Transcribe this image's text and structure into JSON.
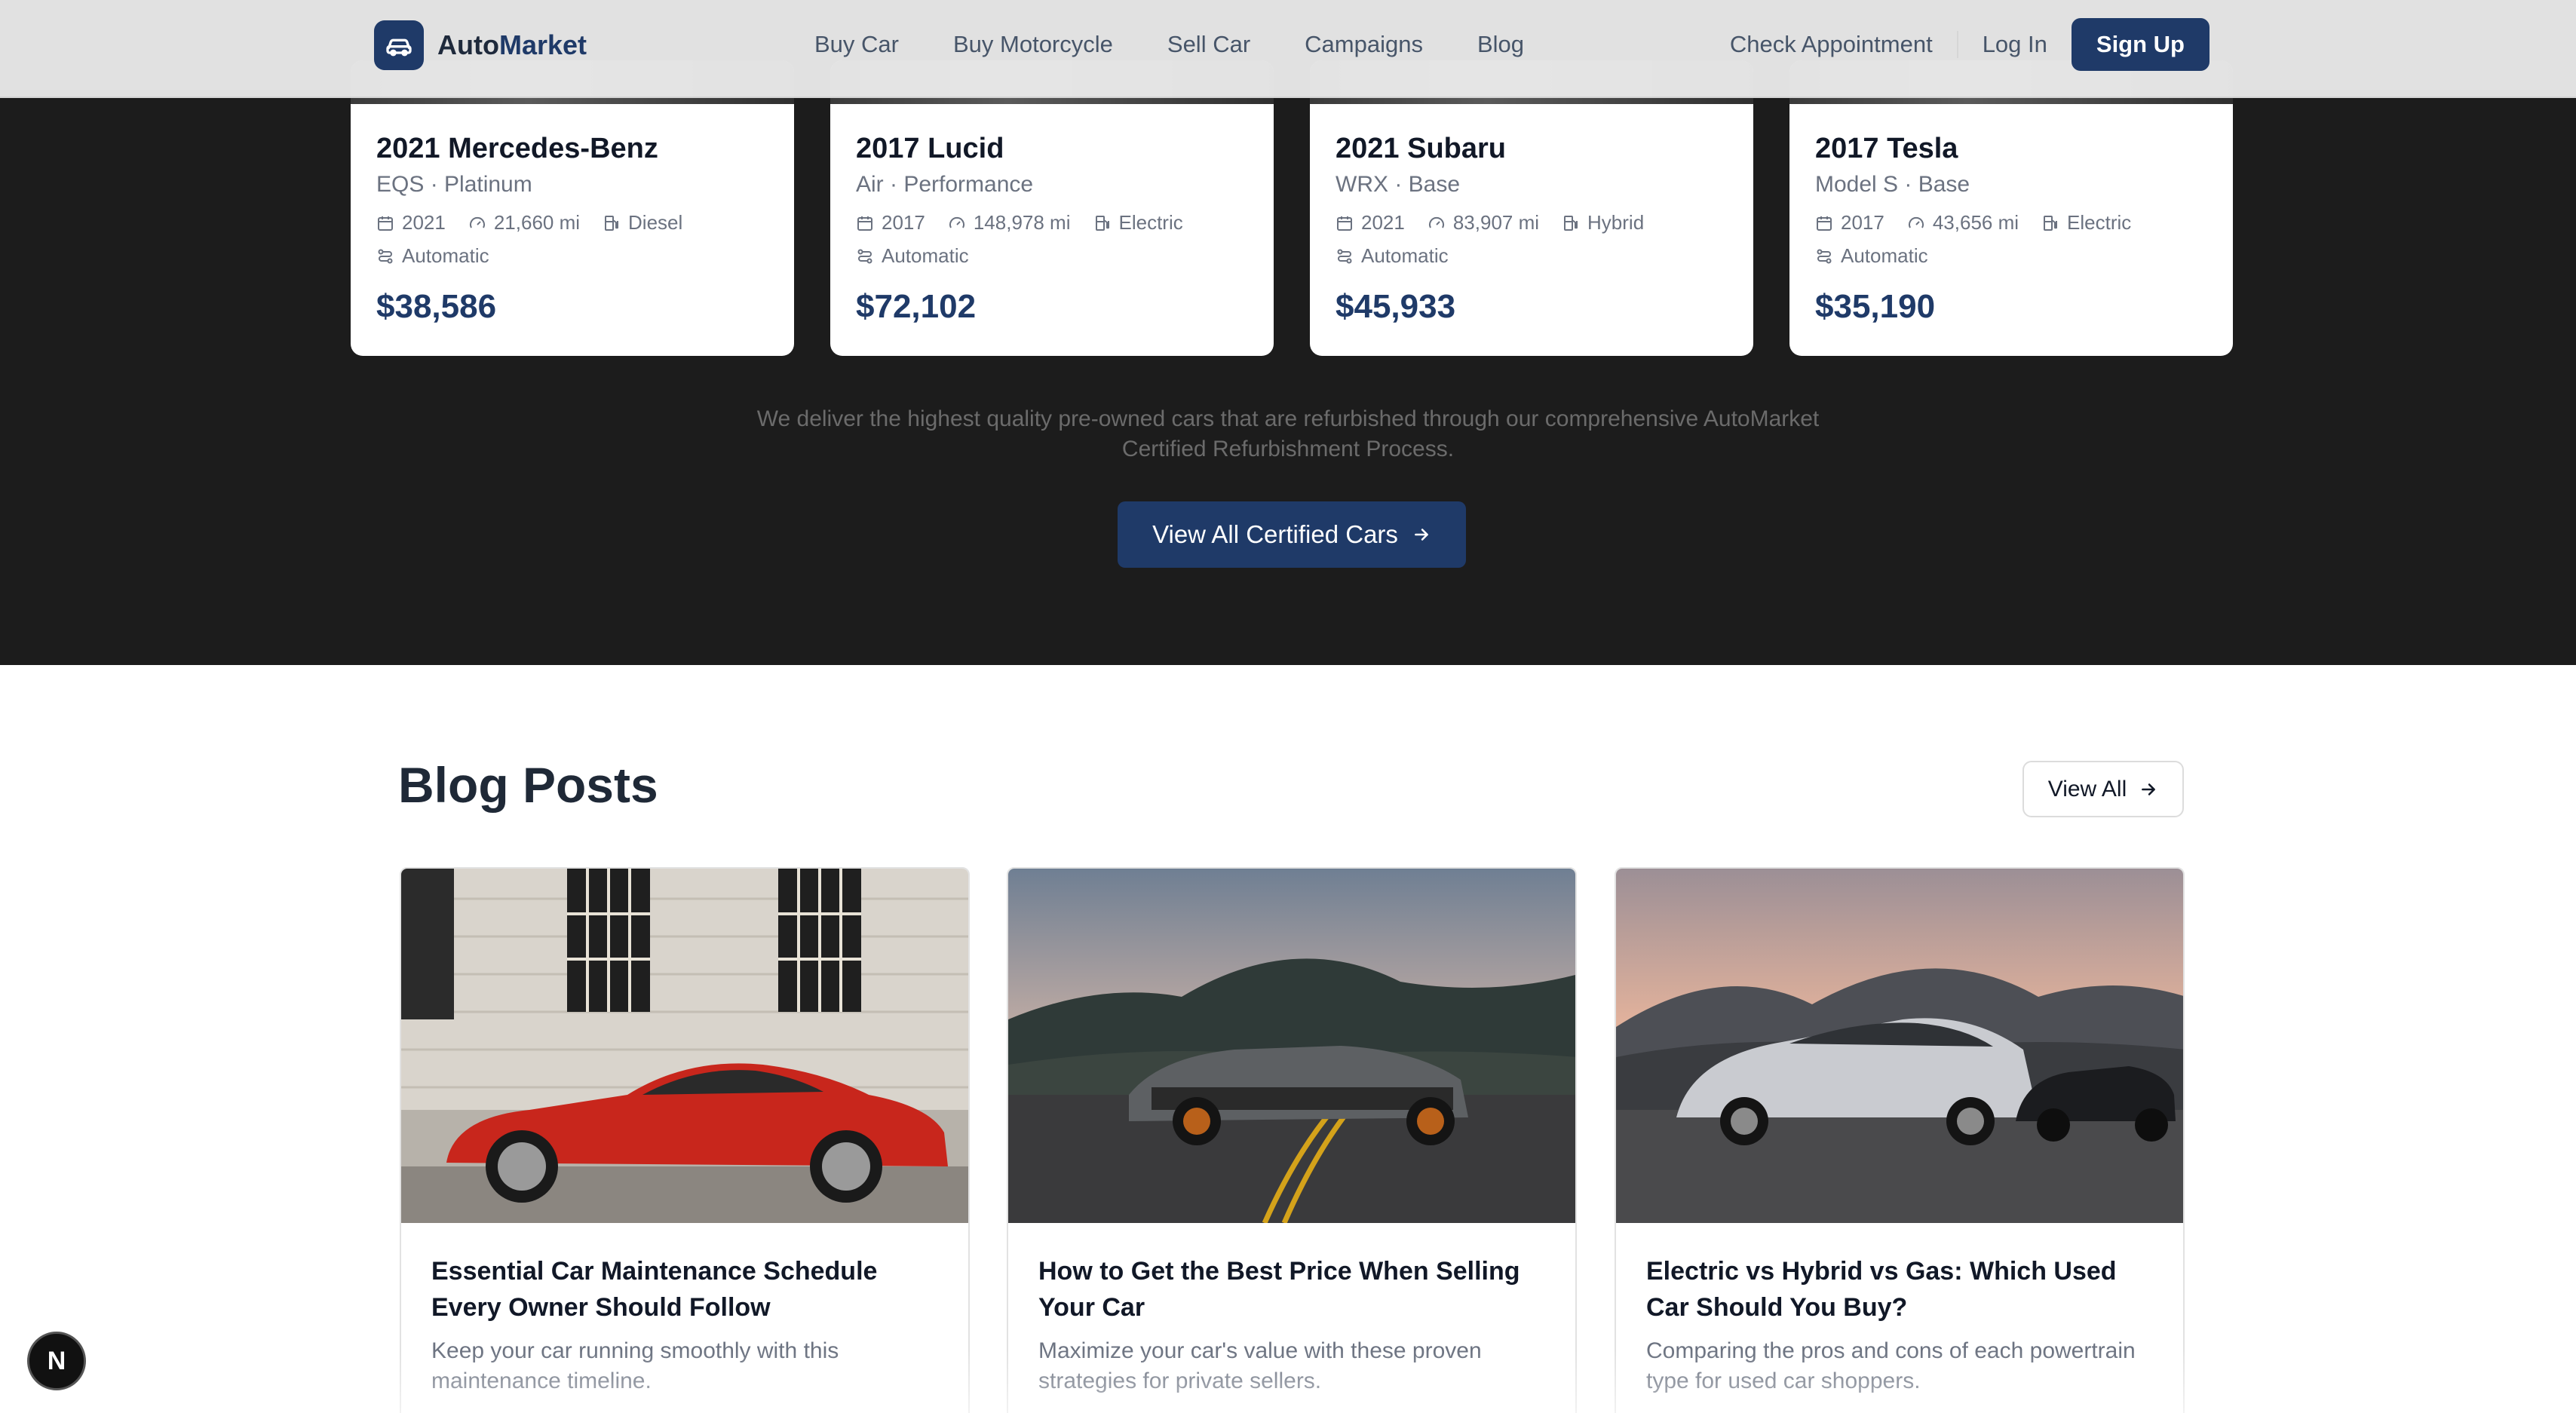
{
  "brand": {
    "name_part1": "Auto",
    "name_part2": "Market"
  },
  "nav": {
    "items": [
      {
        "label": "Buy Car"
      },
      {
        "label": "Buy Motorcycle"
      },
      {
        "label": "Sell Car"
      },
      {
        "label": "Campaigns"
      },
      {
        "label": "Blog"
      }
    ],
    "check_appointment": "Check Appointment",
    "login": "Log In",
    "signup": "Sign Up"
  },
  "certified": {
    "cars": [
      {
        "title": "2021 Mercedes-Benz",
        "subtitle": "EQS · Platinum",
        "year": "2021",
        "mileage": "21,660 mi",
        "fuel": "Diesel",
        "transmission": "Automatic",
        "price": "$38,586"
      },
      {
        "title": "2017 Lucid",
        "subtitle": "Air · Performance",
        "year": "2017",
        "mileage": "148,978 mi",
        "fuel": "Electric",
        "transmission": "Automatic",
        "price": "$72,102"
      },
      {
        "title": "2021 Subaru",
        "subtitle": "WRX · Base",
        "year": "2021",
        "mileage": "83,907 mi",
        "fuel": "Hybrid",
        "transmission": "Automatic",
        "price": "$45,933"
      },
      {
        "title": "2017 Tesla",
        "subtitle": "Model S · Base",
        "year": "2017",
        "mileage": "43,656 mi",
        "fuel": "Electric",
        "transmission": "Automatic",
        "price": "$35,190"
      }
    ],
    "tagline": "We deliver the highest quality pre-owned cars that are refurbished through our comprehensive AutoMarket Certified Refurbishment Process.",
    "view_all_label": "View All Certified Cars"
  },
  "blog": {
    "heading": "Blog Posts",
    "view_all_label": "View All",
    "posts": [
      {
        "title": "Essential Car Maintenance Schedule Every Owner Should Follow",
        "description": "Keep your car running smoothly with this maintenance timeline."
      },
      {
        "title": "How to Get the Best Price When Selling Your Car",
        "description": "Maximize your car's value with these proven strategies for private sellers."
      },
      {
        "title": "Electric vs Hybrid vs Gas: Which Used Car Should You Buy?",
        "description": "Comparing the pros and cons of each powertrain type for used car shoppers."
      }
    ]
  },
  "devtools_badge": "N",
  "colors": {
    "brand": "#1f3a68",
    "dark_section": "#1c1c1c"
  }
}
